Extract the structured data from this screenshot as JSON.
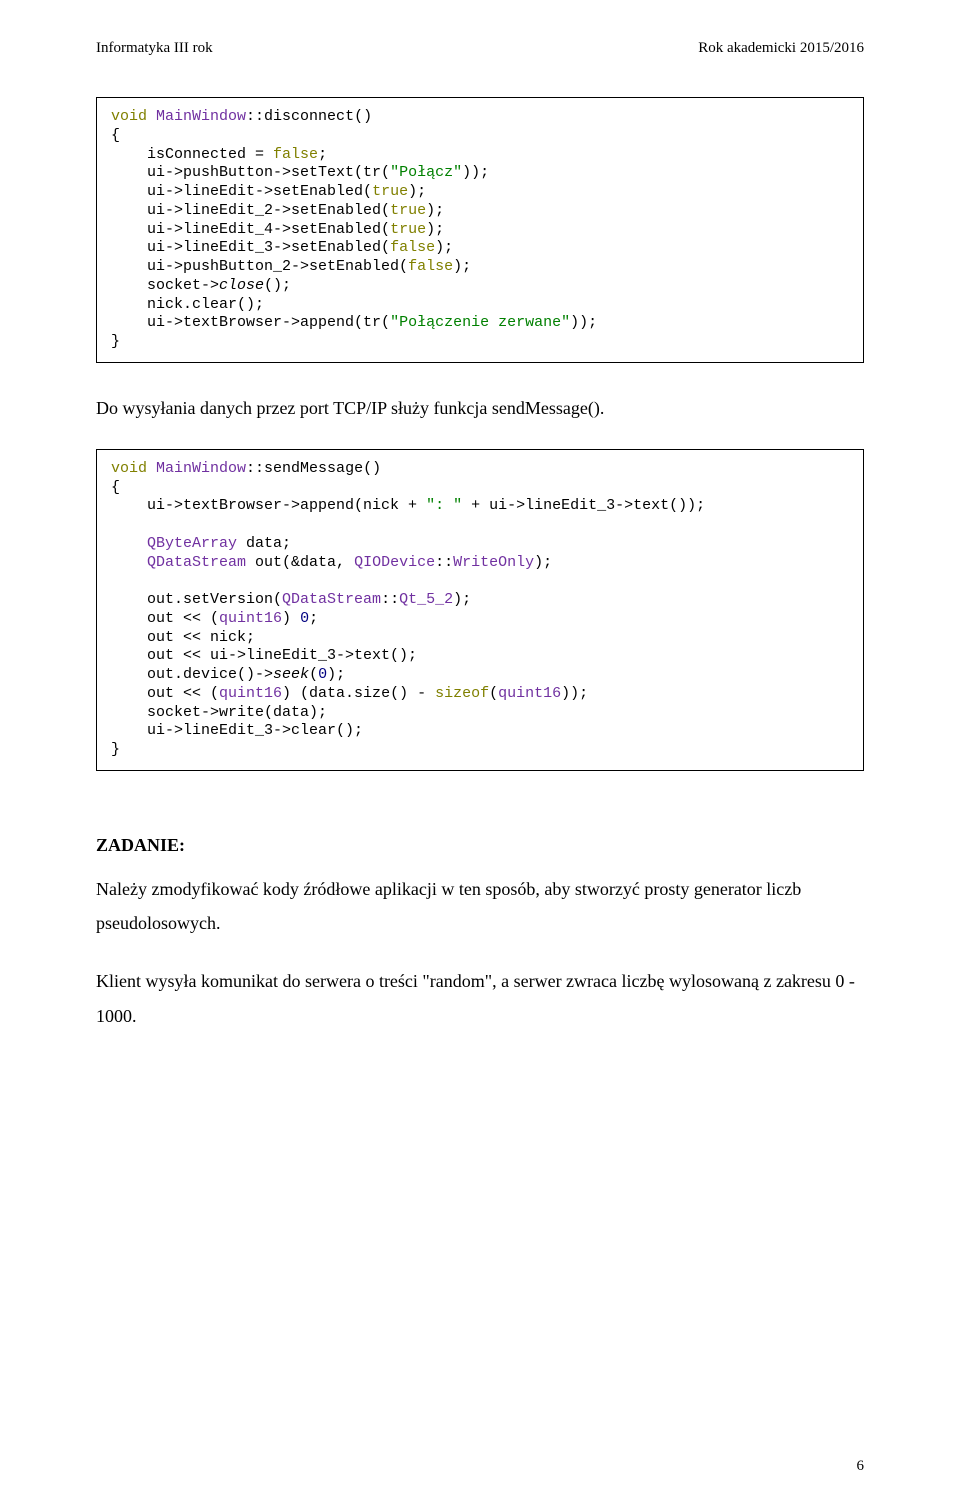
{
  "header": {
    "left": "Informatyka III rok",
    "right": "Rok akademicki 2015/2016"
  },
  "code1": {
    "l1_a": "void",
    "l1_b": " ",
    "l1_c": "MainWindow",
    "l1_d": "::disconnect()",
    "l2": "{",
    "l3_a": "    isConnected = ",
    "l3_b": "false",
    "l3_c": ";",
    "l4_a": "    ui->pushButton->setText(tr(",
    "l4_b": "\"Połącz\"",
    "l4_c": "));",
    "l5_a": "    ui->lineEdit->setEnabled(",
    "l5_b": "true",
    "l5_c": ");",
    "l6_a": "    ui->lineEdit_2->setEnabled(",
    "l6_b": "true",
    "l6_c": ");",
    "l7_a": "    ui->lineEdit_4->setEnabled(",
    "l7_b": "true",
    "l7_c": ");",
    "l8_a": "    ui->lineEdit_3->setEnabled(",
    "l8_b": "false",
    "l8_c": ");",
    "l9_a": "    ui->pushButton_2->setEnabled(",
    "l9_b": "false",
    "l9_c": ");",
    "l10_a": "    socket->",
    "l10_b": "close",
    "l10_c": "();",
    "l11": "    nick.clear();",
    "l12_a": "    ui->textBrowser->append(tr(",
    "l12_b": "\"Połączenie zerwane\"",
    "l12_c": "));",
    "l13": "}"
  },
  "para1": "Do wysyłania danych przez port TCP/IP służy funkcja sendMessage().",
  "code2": {
    "l1_a": "void",
    "l1_b": " ",
    "l1_c": "MainWindow",
    "l1_d": "::sendMessage()",
    "l2": "{",
    "l3_a": "    ui->textBrowser->append(nick + ",
    "l3_b": "\": \"",
    "l3_c": " + ui->lineEdit_3->text());",
    "blank1": "",
    "l4_a": "    ",
    "l4_b": "QByteArray",
    "l4_c": " data;",
    "l5_a": "    ",
    "l5_b": "QDataStream",
    "l5_c": " out(&data, ",
    "l5_d": "QIODevice",
    "l5_e": "::",
    "l5_f": "WriteOnly",
    "l5_g": ");",
    "blank2": "",
    "l6_a": "    out.setVersion(",
    "l6_b": "QDataStream",
    "l6_c": "::",
    "l6_d": "Qt_5_2",
    "l6_e": ");",
    "l7_a": "    out << (",
    "l7_b": "quint16",
    "l7_c": ") ",
    "l7_d": "0",
    "l7_e": ";",
    "l8": "    out << nick;",
    "l9": "    out << ui->lineEdit_3->text();",
    "l10_a": "    out.device()->",
    "l10_b": "seek",
    "l10_c": "(",
    "l10_d": "0",
    "l10_e": ");",
    "l11_a": "    out << (",
    "l11_b": "quint16",
    "l11_c": ") (data.size() - ",
    "l11_d": "sizeof",
    "l11_e": "(",
    "l11_f": "quint16",
    "l11_g": "));",
    "l12": "    socket->write(data);",
    "l13": "    ui->lineEdit_3->clear();",
    "l14": "}"
  },
  "zadanie": {
    "heading": "ZADANIE:",
    "p1": "Należy zmodyfikować kody źródłowe aplikacji w ten sposób, aby stworzyć prosty generator liczb pseudolosowych.",
    "p2": "Klient wysyła komunikat do serwera o treści \"random\", a serwer zwraca liczbę wylosowaną z zakresu 0 - 1000."
  },
  "pageNumber": "6"
}
